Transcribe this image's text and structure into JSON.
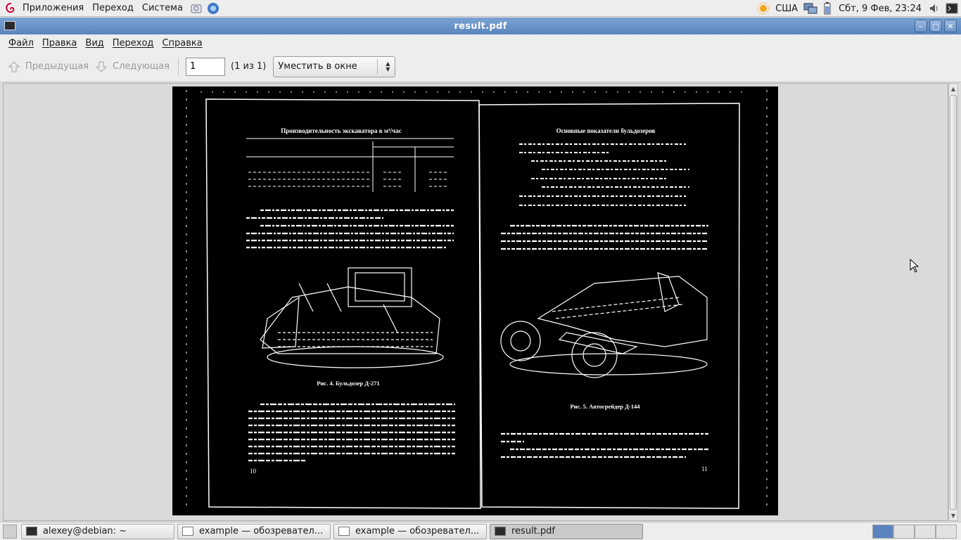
{
  "top_panel": {
    "applications": "Приложения",
    "places": "Переход",
    "system": "Система",
    "keyboard_layout": "США",
    "clock": "Сбт,  9 Фев, 23:24"
  },
  "window": {
    "title": "result.pdf"
  },
  "menubar": {
    "file": "Файл",
    "edit": "Правка",
    "view": "Вид",
    "go": "Переход",
    "help": "Справка"
  },
  "toolbar": {
    "prev_label": "Предыдущая",
    "next_label": "Следующая",
    "page_value": "1",
    "page_of": "(1 из 1)",
    "zoom_value": "Уместить в окне"
  },
  "document": {
    "left_page": {
      "table_title": "Производительность экскаватора в м³/час",
      "caption": "Рис. 4. Бульдозер Д-271",
      "page_number": "10"
    },
    "right_page": {
      "table_title": "Основные показатели бульдозеров",
      "caption": "Рис. 5. Автогрейдер Д-144",
      "page_number": "11"
    }
  },
  "taskbar": {
    "tasks": [
      {
        "label": "alexey@debian: ~",
        "icon": "terminal-icon"
      },
      {
        "label": "example — обозревател...",
        "icon": "document-icon"
      },
      {
        "label": "example — обозревател...",
        "icon": "document-icon"
      },
      {
        "label": "result.pdf",
        "icon": "terminal-icon"
      }
    ]
  },
  "colors": {
    "titlebar": "#5a85bd",
    "panel": "#ededed",
    "page_background": "#000000"
  }
}
